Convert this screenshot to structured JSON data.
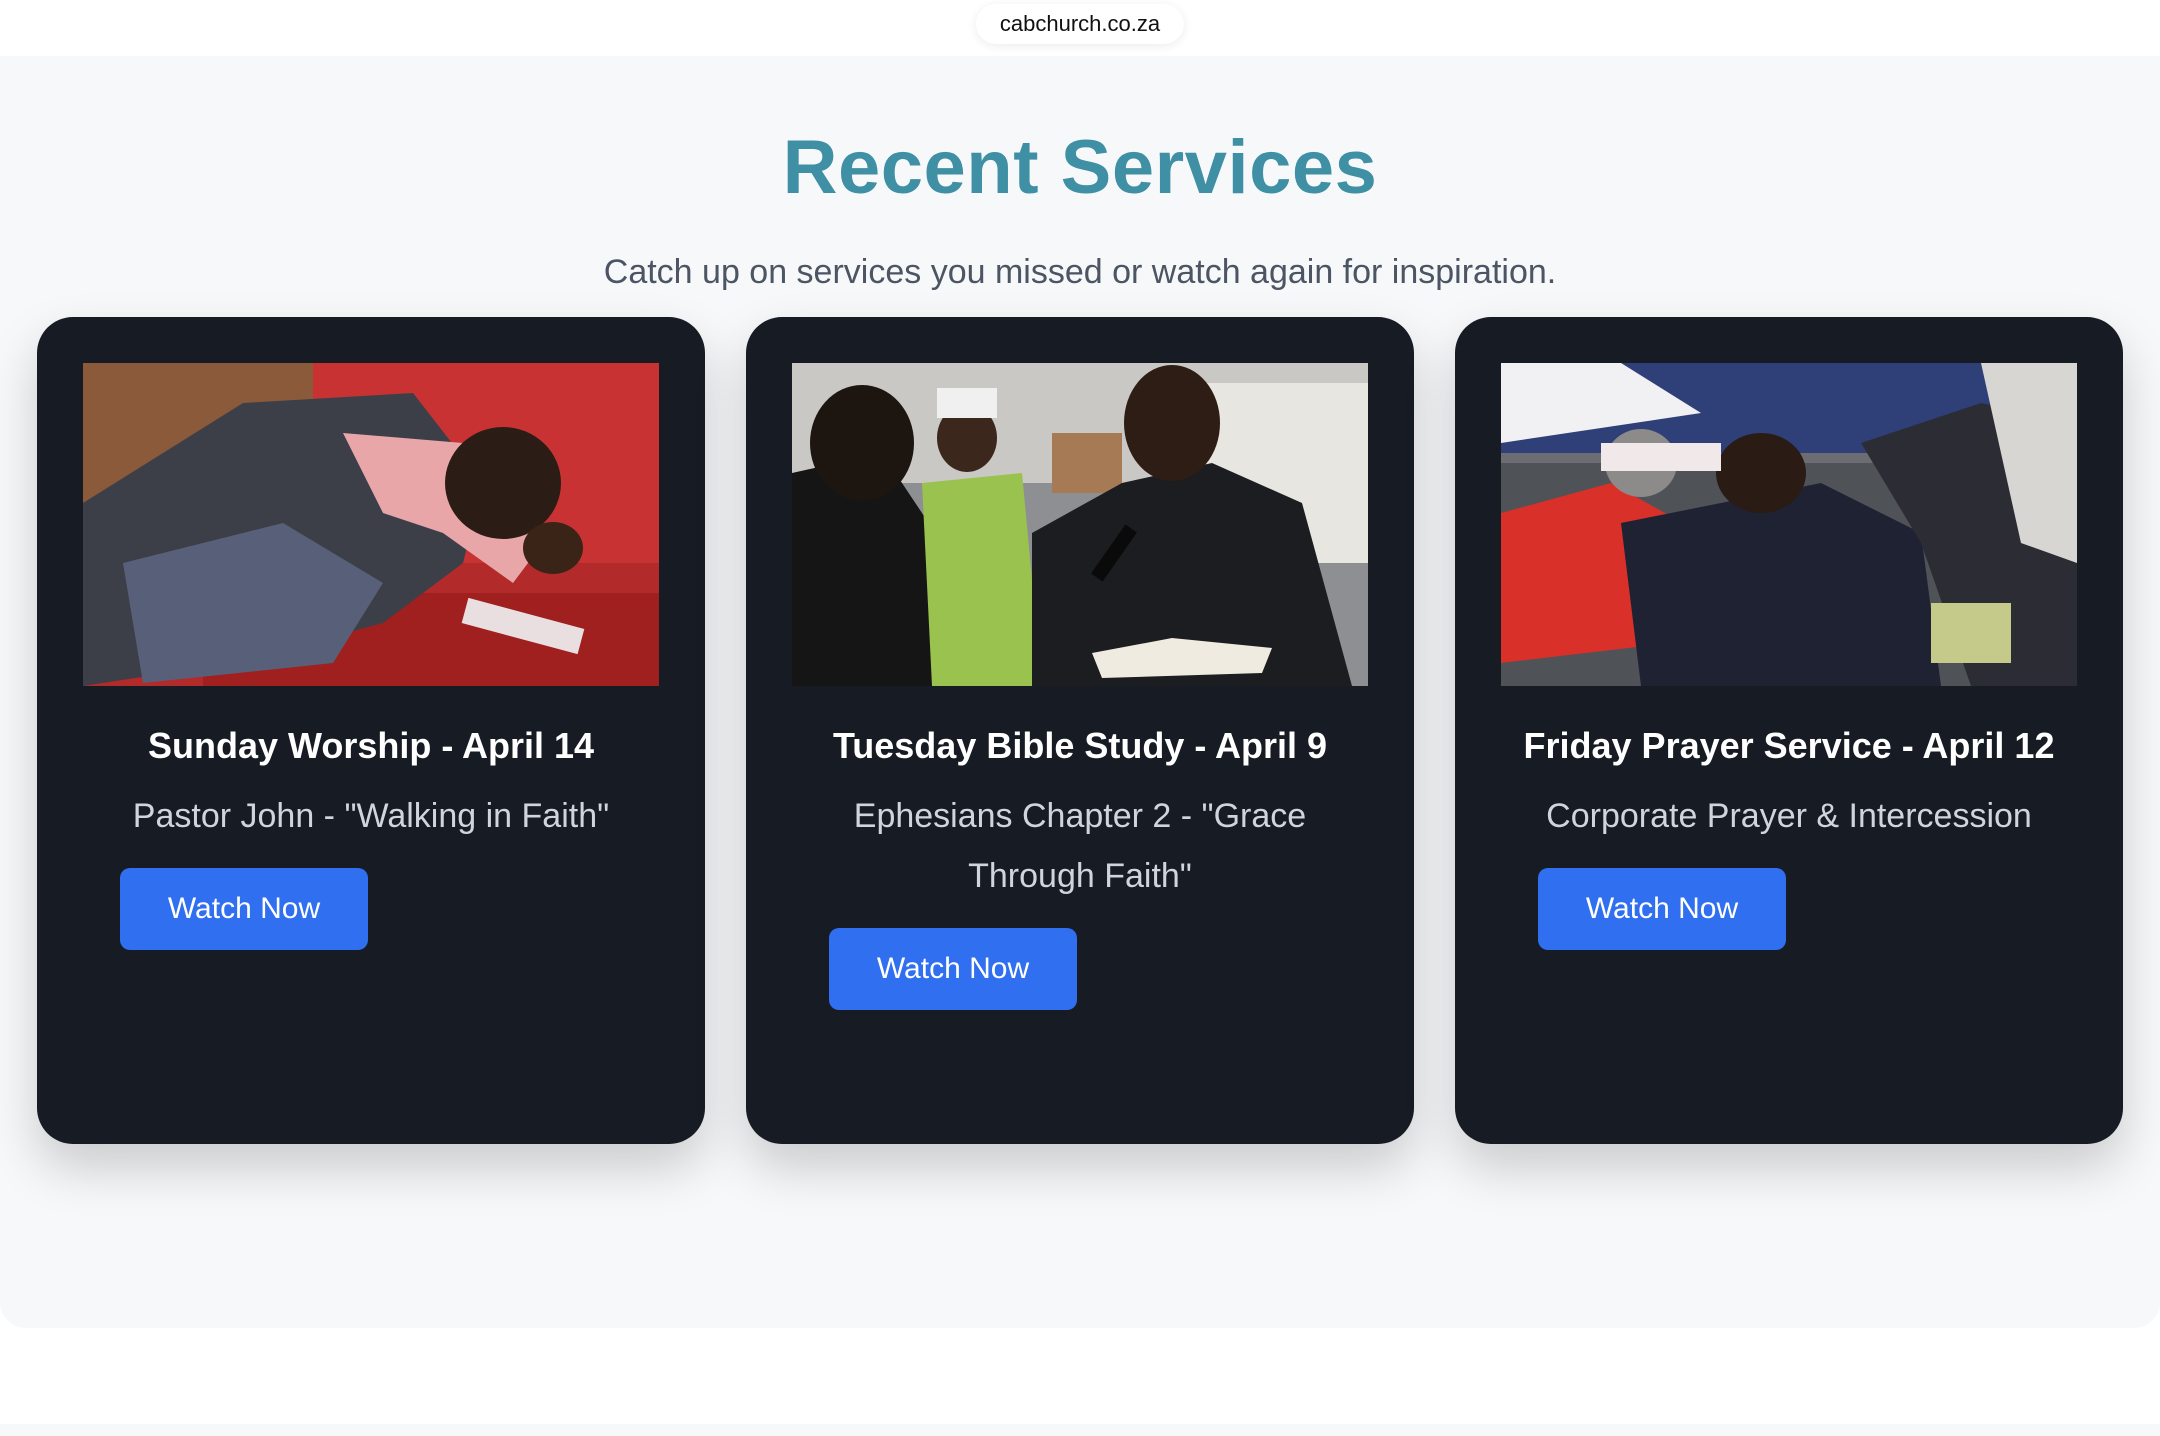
{
  "browser": {
    "url": "cabchurch.co.za"
  },
  "section": {
    "title": "Recent Services",
    "subtitle": "Catch up on services you missed or watch again for inspiration."
  },
  "cards": [
    {
      "title": "Sunday Worship - April 14",
      "description": "Pastor John - \"Walking in Faith\"",
      "button_label": "Watch Now"
    },
    {
      "title": "Tuesday Bible Study - April 9",
      "description": "Ephesians Chapter 2 - \"Grace Through Faith\"",
      "button_label": "Watch Now"
    },
    {
      "title": "Friday Prayer Service - April 12",
      "description": "Corporate Prayer & Intercession",
      "button_label": "Watch Now"
    }
  ],
  "colors": {
    "title_accent": "#3f8fa5",
    "card_background": "#161b24",
    "button_background": "#2f6ff0",
    "section_background": "#f7f8fa"
  }
}
